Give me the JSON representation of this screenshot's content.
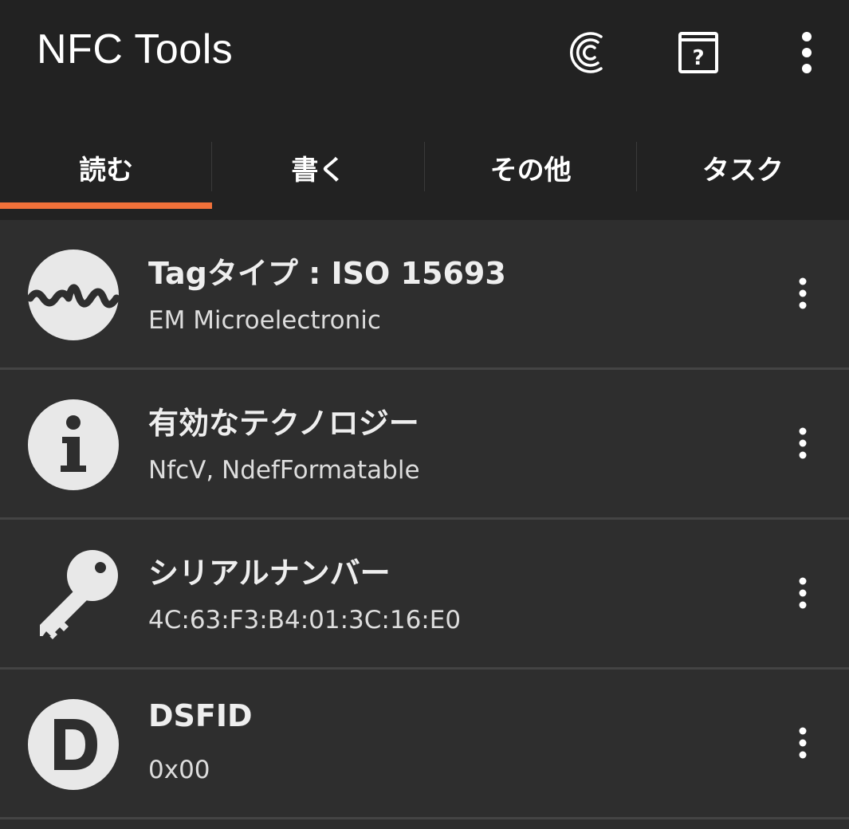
{
  "app": {
    "title": "NFC Tools"
  },
  "toolbar": {
    "actions": [
      {
        "icon": "nfc-c-icon"
      },
      {
        "icon": "help-book-icon"
      },
      {
        "icon": "more-vert-icon"
      }
    ]
  },
  "tabs": [
    {
      "label": "読む",
      "active": true
    },
    {
      "label": "書く",
      "active": false
    },
    {
      "label": "その他",
      "active": false
    },
    {
      "label": "タスク",
      "active": false
    }
  ],
  "rows": [
    {
      "icon": "waveform-icon",
      "title": "Tagタイプ : ISO 15693",
      "subtitle": "EM Microelectronic"
    },
    {
      "icon": "info-icon",
      "title": "有効なテクノロジー",
      "subtitle": "NfcV, NdefFormatable"
    },
    {
      "icon": "key-icon",
      "title": "シリアルナンバー",
      "subtitle": "4C:63:F3:B4:01:3C:16:E0"
    },
    {
      "icon": "letter-d-icon",
      "title": "DSFID",
      "subtitle": "0x00"
    }
  ],
  "colors": {
    "toolbar_bg": "#222222",
    "list_bg": "#2e2e2e",
    "accent": "#f0713a",
    "icon": "#e8e8e8"
  }
}
